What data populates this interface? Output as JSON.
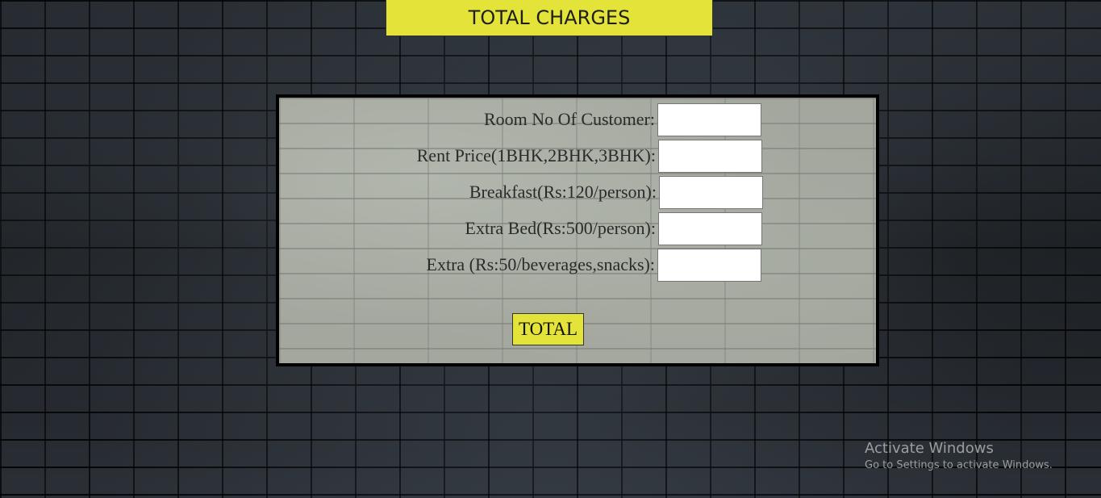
{
  "header": {
    "title": "TOTAL CHARGES"
  },
  "form": {
    "fields": [
      {
        "label": "Room No Of Customer:",
        "value": ""
      },
      {
        "label": "Rent Price(1BHK,2BHK,3BHK):",
        "value": ""
      },
      {
        "label": "Breakfast(Rs:120/person):",
        "value": ""
      },
      {
        "label": "Extra Bed(Rs:500/person):",
        "value": ""
      },
      {
        "label": "Extra (Rs:50/beverages,snacks):",
        "value": ""
      }
    ],
    "submit_label": "TOTAL"
  },
  "watermark": {
    "title": "Activate Windows",
    "subtitle": "Go to Settings to activate Windows."
  },
  "colors": {
    "accent": "#e3e33a",
    "panel": "#a3a79e",
    "background": "#1b1e21"
  }
}
